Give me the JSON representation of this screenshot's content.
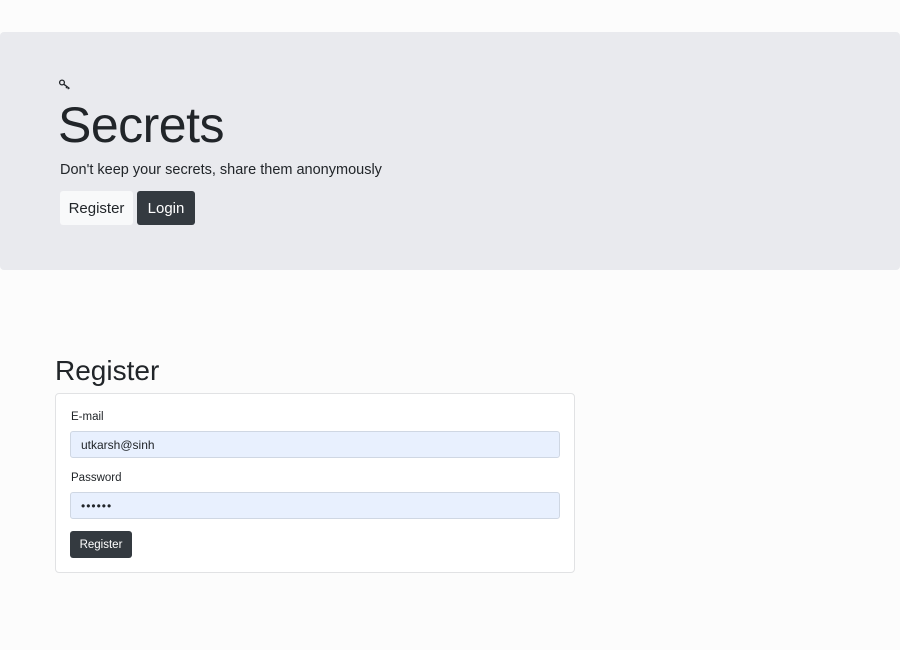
{
  "header": {
    "icon": "key-icon",
    "title": "Secrets",
    "subtitle": "Don't keep your secrets, share them anonymously",
    "buttons": {
      "register_label": "Register",
      "login_label": "Login"
    }
  },
  "register_form": {
    "heading": "Register",
    "email_label": "E-mail",
    "email_value": "utkarsh@sinh",
    "password_label": "Password",
    "password_value": "••••••",
    "submit_label": "Register"
  },
  "colors": {
    "jumbotron_bg": "#e9eaee",
    "dark_button": "#343a40",
    "light_button": "#f8f9fa",
    "autofill_bg": "#e8f0fe"
  }
}
